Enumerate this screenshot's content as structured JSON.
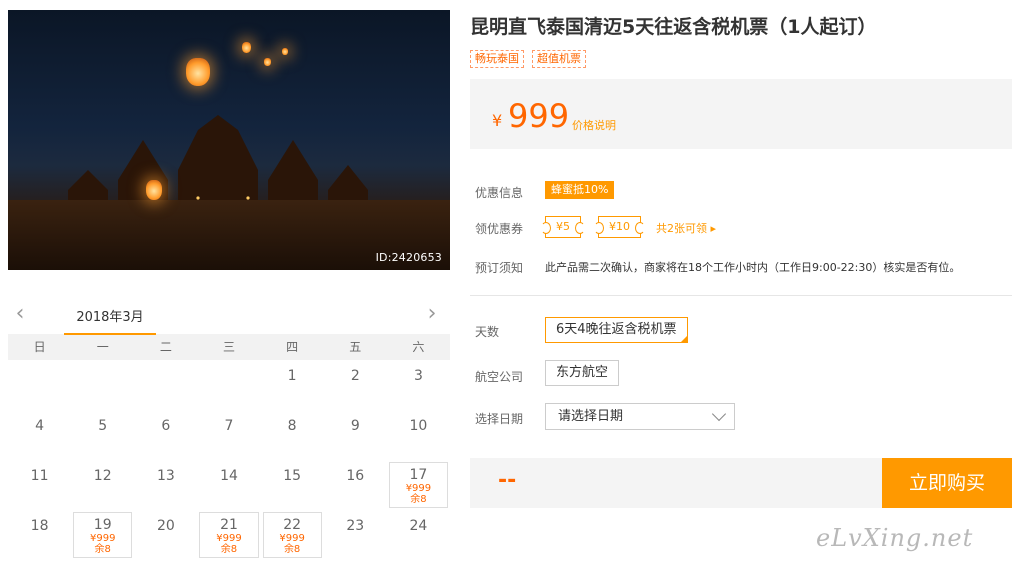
{
  "hero": {
    "image_id": "ID:2420653"
  },
  "product": {
    "title": "昆明直飞泰国清迈5天往返含税机票（1人起订）",
    "tags": [
      "畅玩泰国",
      "超值机票"
    ],
    "price_symbol": "¥",
    "price": "999",
    "price_note": "价格说明"
  },
  "info": {
    "promo_label": "优惠信息",
    "promo_badge": "蜂蜜抵10%",
    "coupon_label": "领优惠券",
    "coupons": [
      "¥5",
      "¥10"
    ],
    "coupon_more": "共2张可领 ▸",
    "notice_label": "预订须知",
    "notice_text": "此产品需二次确认，商家将在18个工作小时内（工作日9:00-22:30）核实是否有位。"
  },
  "options": {
    "days_label": "天数",
    "days_value": "6天4晚往返含税机票",
    "airline_label": "航空公司",
    "airline_value": "东方航空",
    "date_label": "选择日期",
    "date_placeholder": "请选择日期"
  },
  "buy": {
    "total": "--",
    "button_label": "立即购买"
  },
  "calendar": {
    "month": "2018年3月",
    "prev": "‹",
    "next": "›",
    "weekdays": [
      "日",
      "一",
      "二",
      "三",
      "四",
      "五",
      "六"
    ],
    "rows": [
      [
        null,
        null,
        null,
        null,
        {
          "d": "1"
        },
        {
          "d": "2"
        },
        {
          "d": "3"
        }
      ],
      [
        {
          "d": "4"
        },
        {
          "d": "5"
        },
        {
          "d": "6"
        },
        {
          "d": "7"
        },
        {
          "d": "8"
        },
        {
          "d": "9"
        },
        {
          "d": "10"
        }
      ],
      [
        {
          "d": "11"
        },
        {
          "d": "12"
        },
        {
          "d": "13"
        },
        {
          "d": "14"
        },
        {
          "d": "15"
        },
        {
          "d": "16"
        },
        {
          "d": "17",
          "price": "¥999",
          "stock": "余8"
        }
      ],
      [
        {
          "d": "18"
        },
        {
          "d": "19",
          "price": "¥999",
          "stock": "余8"
        },
        {
          "d": "20"
        },
        {
          "d": "21",
          "price": "¥999",
          "stock": "余8"
        },
        {
          "d": "22",
          "price": "¥999",
          "stock": "余8"
        },
        {
          "d": "23"
        },
        {
          "d": "24"
        }
      ]
    ]
  },
  "watermark": "eLvXing.net"
}
